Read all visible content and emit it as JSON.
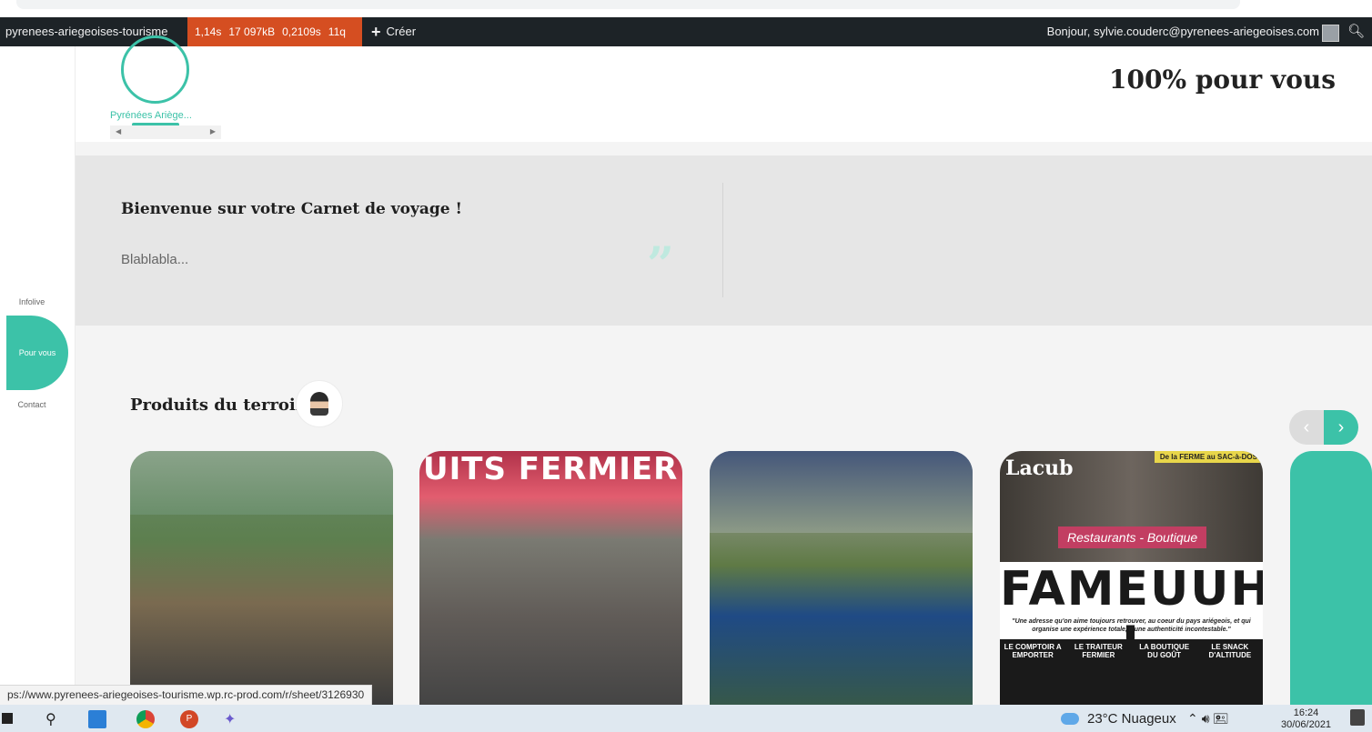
{
  "admin_bar": {
    "site_name": "pyrenees-ariegeoises-tourisme",
    "perf": [
      "1,14s",
      "17 097kB",
      "0,2109s",
      "11q"
    ],
    "create_label": "Créer",
    "greeting": "Bonjour, sylvie.couderc@pyrenees-ariegeoises.com",
    "search_icon": "search-icon"
  },
  "sidebar": {
    "items": [
      {
        "label": "Infolive"
      },
      {
        "label": "Pour vous"
      },
      {
        "label": "Contact"
      }
    ]
  },
  "header": {
    "logo_text": "Pyrénées Ariège...",
    "tagline": "100% pour vous"
  },
  "banner": {
    "title": "Bienvenue sur votre Carnet de voyage !",
    "body": "Blablabla...",
    "quote_mark": "”"
  },
  "products": {
    "title": "Produits du terroir",
    "nav_prev": "‹",
    "nav_next": "›",
    "cards": [
      {
        "sign": ""
      },
      {
        "sign": "UITS FERMIER"
      },
      {
        "sign": ""
      },
      {
        "brand": "Lacub",
        "corner": "De la FERME au SAC-à-DOS",
        "ribbon": "Restaurants - Boutique",
        "headline": "FAMEUUH !",
        "quote": "\"Une adresse qu'on aime toujours retrouver, au coeur du pays ariégeois, et qui organise une expérience totale, d'une authenticité incontestable.\"",
        "cols": [
          "LE COMPTOIR A EMPORTER",
          "LE TRAITEUR FERMIER",
          "LA BOUTIQUE DU GOÛT",
          "LE SNACK D'ALTITUDE"
        ]
      }
    ]
  },
  "status_link": "ps://www.pyrenees-ariegeoises-tourisme.wp.rc-prod.com/r/sheet/3126930",
  "taskbar": {
    "weather": "23°C  Nuageux",
    "time": "16:24",
    "date": "30/06/2021"
  },
  "colors": {
    "accent": "#3cc2a8",
    "admin_bar": "#1d2327",
    "perf": "#d54e21"
  }
}
